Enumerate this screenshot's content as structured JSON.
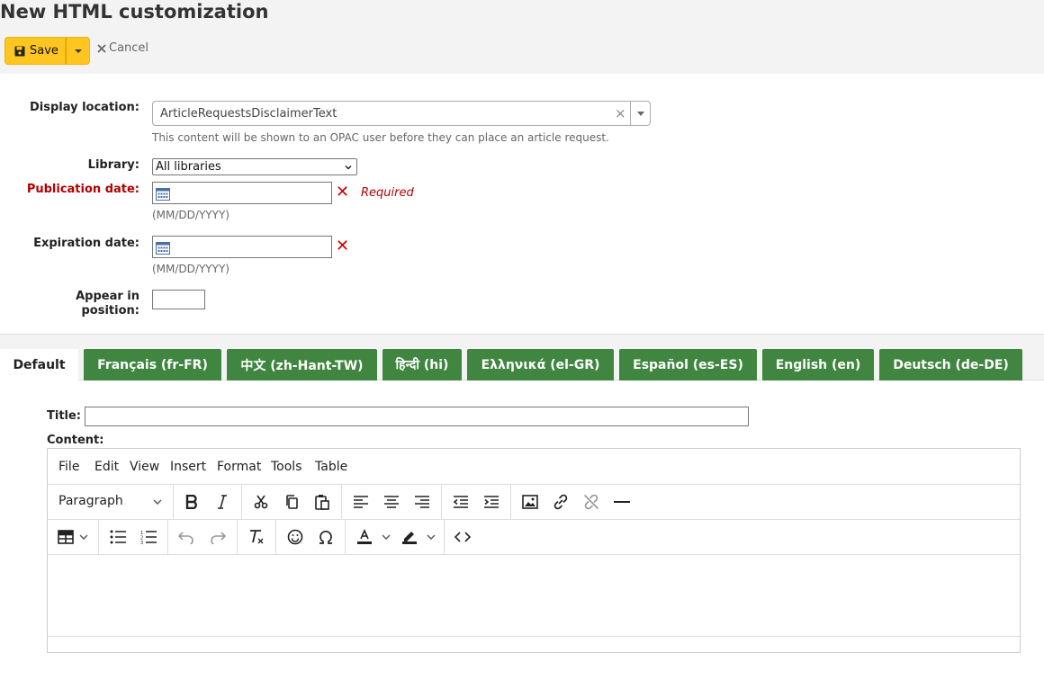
{
  "page": {
    "title": "New HTML customization"
  },
  "toolbar": {
    "save_label": "Save",
    "cancel_label": "Cancel"
  },
  "form": {
    "display_location": {
      "label": "Display location:",
      "value": "ArticleRequestsDisclaimerText",
      "hint": "This content will be shown to an OPAC user before they can place an article request."
    },
    "library": {
      "label": "Library:",
      "value": "All libraries"
    },
    "publication_date": {
      "label": "Publication date:",
      "value": "",
      "hint": "(MM/DD/YYYY)",
      "required": "Required"
    },
    "expiration_date": {
      "label": "Expiration date:",
      "value": "",
      "hint": "(MM/DD/YYYY)"
    },
    "position": {
      "label_line1": "Appear in",
      "label_line2": "position:",
      "value": ""
    }
  },
  "tabs": [
    {
      "label": "Default",
      "active": true
    },
    {
      "label": "Français (fr-FR)"
    },
    {
      "label": "中文 (zh-Hant-TW)"
    },
    {
      "label": "हिन्दी (hi)"
    },
    {
      "label": "Ελληνικά (el-GR)"
    },
    {
      "label": "Español (es-ES)"
    },
    {
      "label": "English (en)"
    },
    {
      "label": "Deutsch (de-DE)"
    }
  ],
  "content": {
    "title_label": "Title:",
    "title_value": "",
    "content_label": "Content:"
  },
  "editor": {
    "menu": [
      "File",
      "Edit",
      "View",
      "Insert",
      "Format",
      "Tools",
      "Table"
    ],
    "block_format": "Paragraph"
  },
  "colors": {
    "save": "#ffc520",
    "tab": "#408540",
    "required": "#b30000"
  }
}
